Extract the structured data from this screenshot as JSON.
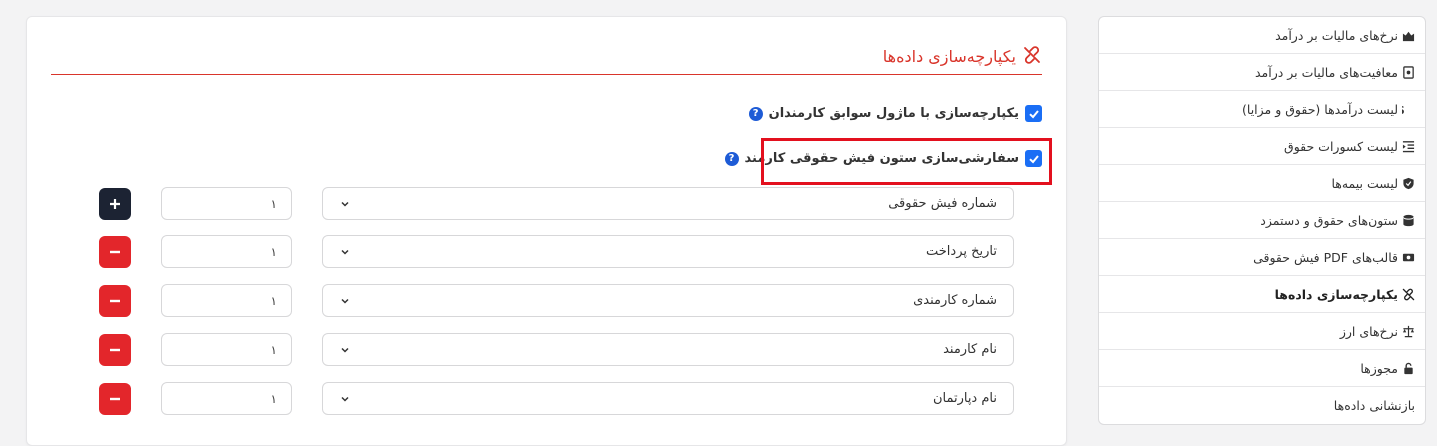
{
  "main": {
    "title": "یکپارچه‌سازی داده‌ها",
    "title_color": "#d9352b",
    "option1_label": "یکپارچه‌سازی با ماژول سوابق کارمندان",
    "option1_checked": true,
    "option2_label": "سفارشی‌سازی ستون فیش حقوقی کارمند",
    "option2_checked": true,
    "help_symbol": "?",
    "rows": [
      {
        "column": "شماره فیش حقوقی",
        "value": "۱",
        "action": "add"
      },
      {
        "column": "تاریخ پرداخت",
        "value": "۱",
        "action": "remove"
      },
      {
        "column": "شماره کارمندی",
        "value": "۱",
        "action": "remove"
      },
      {
        "column": "نام کارمند",
        "value": "۱",
        "action": "remove"
      },
      {
        "column": "نام دپارتمان",
        "value": "۱",
        "action": "remove"
      }
    ]
  },
  "sidebar": {
    "items": [
      {
        "label": "نرخ‌های مالیات بر درآمد",
        "icon": "chart-area-icon"
      },
      {
        "label": "معافیت‌های مالیات بر درآمد",
        "icon": "receipt-icon"
      },
      {
        "label": "لیست درآمدها (حقوق و مزایا)",
        "icon": "dollar-icon"
      },
      {
        "label": "لیست کسورات حقوق",
        "icon": "list-indent-icon"
      },
      {
        "label": "لیست بیمه‌ها",
        "icon": "shield-icon"
      },
      {
        "label": "ستون‌های حقوق و دستمزد",
        "icon": "database-icon"
      },
      {
        "label": "قالب‌های PDF فیش حقوقی",
        "icon": "money-bill-icon"
      },
      {
        "label": "یکپارچه‌سازی داده‌ها",
        "icon": "unlink-icon",
        "active": true
      },
      {
        "label": "نرخ‌های ارز",
        "icon": "scale-icon"
      },
      {
        "label": "مجوزها",
        "icon": "lock-icon"
      },
      {
        "label": "بازنشانی داده‌ها",
        "icon": ""
      }
    ]
  },
  "colors": {
    "accent_red": "#d9352b",
    "checkbox_blue": "#1a6ef5",
    "add_button": "#1c2333",
    "remove_button": "#e3262b",
    "highlight_box": "#e3101e"
  }
}
